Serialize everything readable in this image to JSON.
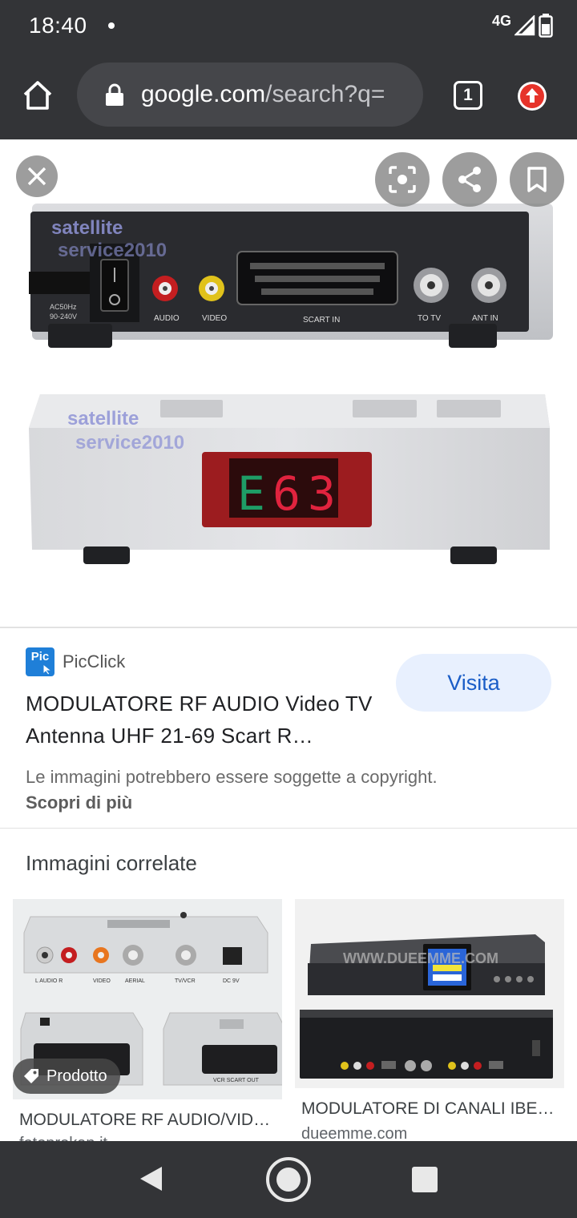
{
  "status_bar": {
    "time": "18:40",
    "network": "4G"
  },
  "browser": {
    "url_host": "google.com",
    "url_path": "/search?q=",
    "tab_count": "1"
  },
  "photo": {
    "watermark_line1": "satellite",
    "watermark_line2": "service2010",
    "rear_labels": {
      "power": "AC50Hz",
      "voltage": "90-240V",
      "audio": "AUDIO",
      "video": "VIDEO",
      "scart": "SCART IN",
      "to_tv": "TO TV",
      "ant_in": "ANT IN"
    },
    "display_chars": [
      "E",
      "6",
      "3"
    ]
  },
  "result": {
    "source": "PicClick",
    "favicon_text": "Pic",
    "title": "MODULATORE RF AUDIO Video TV Antenna UHF 21-69 Scart R…",
    "visit_label": "Visita",
    "copyright_text": "Le immagini potrebbero essere soggette a copyright.",
    "copyright_link": "Scopri di più"
  },
  "related": {
    "heading": "Immagini correlate",
    "items": [
      {
        "title": "MODULATORE RF AUDIO/VID…",
        "domain": "fotoprokan.it",
        "badge": "Prodotto",
        "labels": [
          "L AUDIO R",
          "VIDEO",
          "AERIAL",
          "TV/VCR",
          "DC 9V",
          "VCR SCART OUT"
        ]
      },
      {
        "title": "MODULATORE DI CANALI IBE…",
        "domain": "dueemme.com",
        "watermark": "WWW.DUEEMME.COM"
      }
    ]
  },
  "colors": {
    "chrome": "#333437",
    "accent": "#1a5dc7",
    "visit_bg": "#e8f0fe"
  }
}
